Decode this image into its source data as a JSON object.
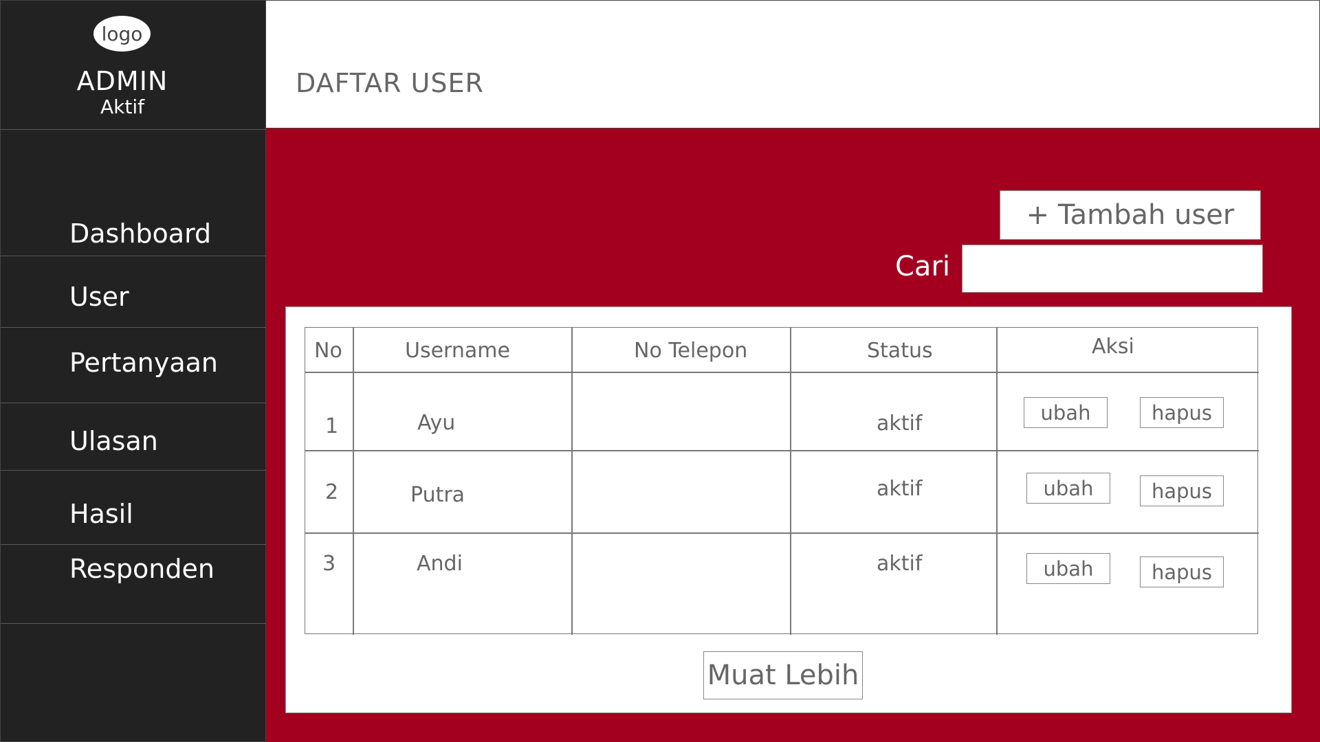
{
  "sidebar": {
    "logo_text": "logo",
    "admin_name": "ADMIN",
    "admin_status": "Aktif",
    "items": [
      {
        "label": "Dashboard"
      },
      {
        "label": "User"
      },
      {
        "label": "Pertanyaan"
      },
      {
        "label": "Ulasan"
      },
      {
        "label": "Hasil"
      },
      {
        "label": "Responden"
      }
    ]
  },
  "header": {
    "title": "DAFTAR USER"
  },
  "toolbar": {
    "add_label": "+ Tambah user",
    "search_label": "Cari",
    "search_value": ""
  },
  "table": {
    "columns": [
      "No",
      "Username",
      "No Telepon",
      "Status",
      "Aksi"
    ],
    "rows": [
      {
        "no": "1",
        "username": "Ayu",
        "phone": "",
        "status": "aktif",
        "edit": "ubah",
        "delete": "hapus"
      },
      {
        "no": "2",
        "username": "Putra",
        "phone": "",
        "status": "aktif",
        "edit": "ubah",
        "delete": "hapus"
      },
      {
        "no": "3",
        "username": "Andi",
        "phone": "",
        "status": "aktif",
        "edit": "ubah",
        "delete": "hapus"
      }
    ],
    "load_more_label": "Muat Lebih"
  },
  "colors": {
    "sidebar_bg": "#222222",
    "accent_red": "#a3001f",
    "text_gray": "#666666"
  }
}
